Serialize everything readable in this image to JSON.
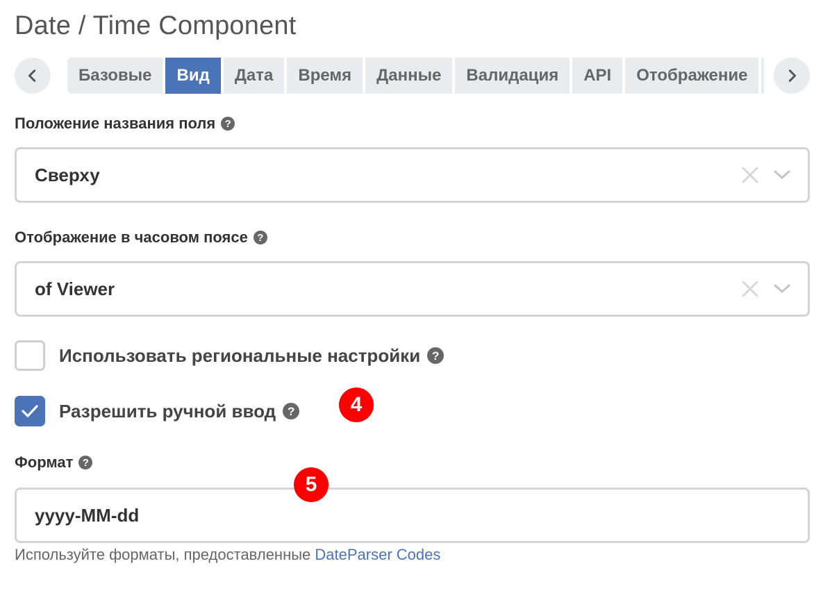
{
  "title": "Date / Time Component",
  "tabs": [
    {
      "label": "Базовые",
      "active": false
    },
    {
      "label": "Вид",
      "active": true
    },
    {
      "label": "Дата",
      "active": false
    },
    {
      "label": "Время",
      "active": false
    },
    {
      "label": "Данные",
      "active": false
    },
    {
      "label": "Валидация",
      "active": false
    },
    {
      "label": "API",
      "active": false
    },
    {
      "label": "Отображение",
      "active": false
    }
  ],
  "label_position": {
    "label": "Положение названия поля",
    "value": "Сверху"
  },
  "timezone": {
    "label": "Отображение в часовом поясе",
    "value": "of Viewer"
  },
  "use_locale": {
    "label": "Использовать региональные настройки",
    "checked": false
  },
  "allow_input": {
    "label": "Разрешить ручной ввод",
    "checked": true
  },
  "format": {
    "label": "Формат",
    "value": "yyyy-MM-dd",
    "hint_prefix": "Используйте форматы, предоставленные ",
    "hint_link": "DateParser Codes"
  },
  "help_symbol": "?",
  "badges": [
    "4",
    "5"
  ],
  "colors": {
    "accent": "#4b74b8",
    "tab_bg": "#e9ecef",
    "badge": "#ff0000"
  }
}
